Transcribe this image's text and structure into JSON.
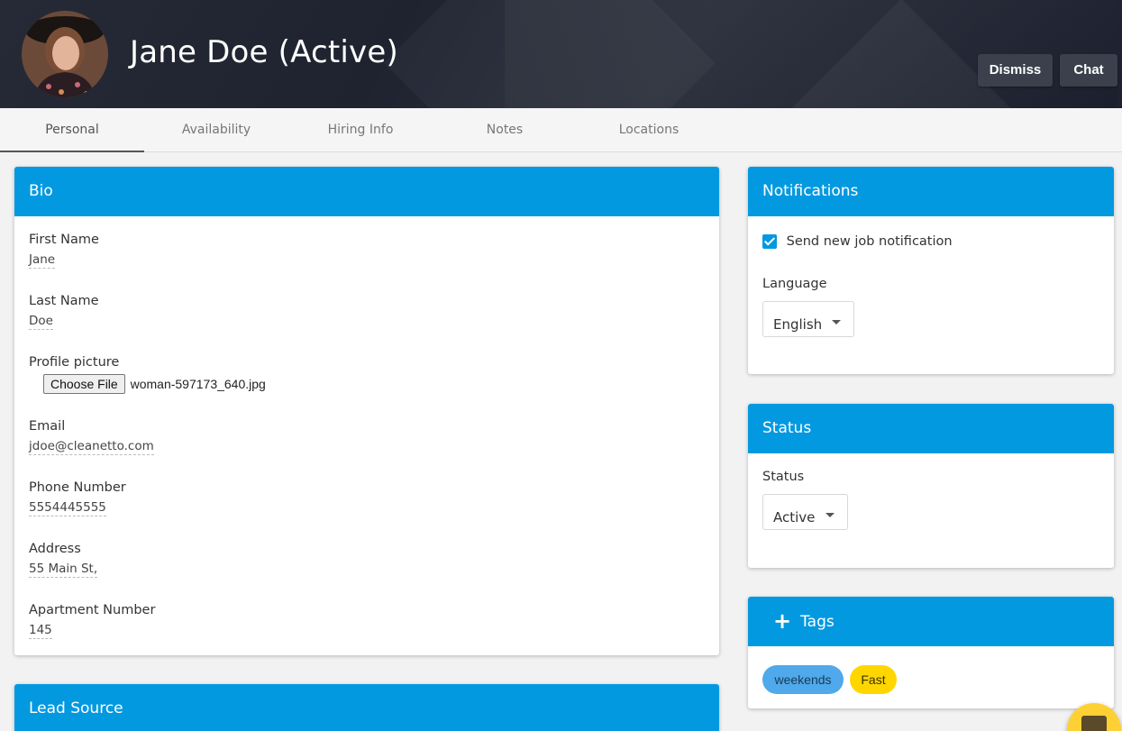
{
  "header": {
    "title": "Jane Doe (Active)",
    "dismiss_label": "Dismiss",
    "chat_label": "Chat"
  },
  "tabs": [
    {
      "label": "Personal",
      "active": true
    },
    {
      "label": "Availability",
      "active": false
    },
    {
      "label": "Hiring Info",
      "active": false
    },
    {
      "label": "Notes",
      "active": false
    },
    {
      "label": "Locations",
      "active": false
    }
  ],
  "bio": {
    "title": "Bio",
    "first_name_label": "First Name",
    "first_name": "Jane",
    "last_name_label": "Last Name",
    "last_name": "Doe",
    "profile_picture_label": "Profile picture",
    "choose_file_label": "Choose File",
    "file_name": "woman-597173_640.jpg",
    "email_label": "Email",
    "email": "jdoe@cleanetto.com",
    "phone_label": "Phone Number",
    "phone": "5554445555",
    "address_label": "Address",
    "address": "55 Main St,",
    "apartment_label": "Apartment Number",
    "apartment": "145"
  },
  "lead_source": {
    "title": "Lead Source"
  },
  "notifications": {
    "title": "Notifications",
    "send_job_label": "Send new job notification",
    "send_job_checked": true,
    "language_label": "Language",
    "language": "English"
  },
  "status": {
    "title": "Status",
    "status_label": "Status",
    "status_value": "Active"
  },
  "tags": {
    "title": "Tags",
    "items": [
      "weekends",
      "Fast"
    ]
  },
  "colors": {
    "accent": "#0399e1",
    "header_bg": "#232733",
    "tag_blue": "#4fa9ea",
    "tag_yellow": "#ffd600",
    "fab": "#ffd033"
  },
  "icons": {
    "avatar": "profile-photo",
    "checkbox": "check-icon",
    "caret": "caret-down-icon",
    "add_tag": "plus-icon",
    "fab": "chat-icon"
  }
}
